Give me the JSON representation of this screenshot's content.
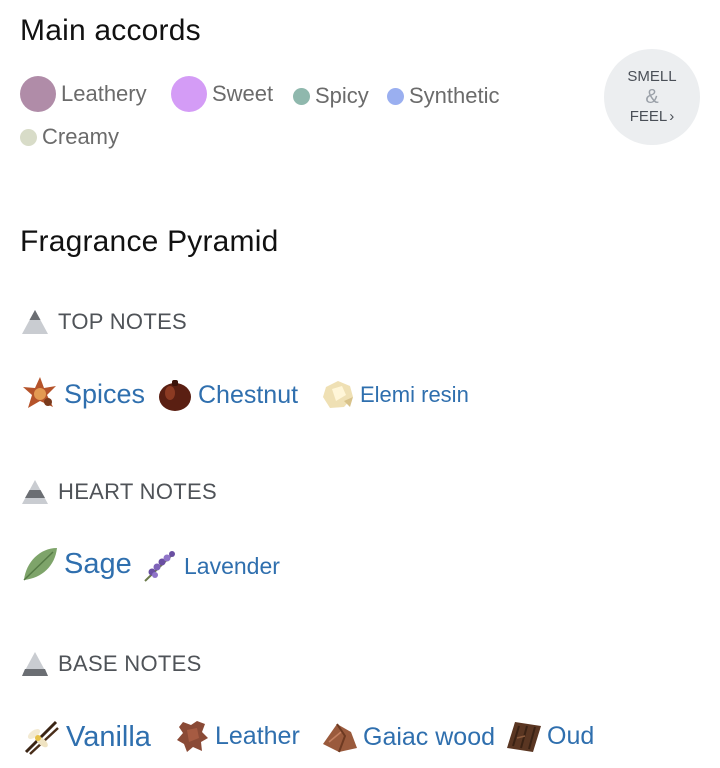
{
  "main_accords": {
    "title": "Main accords",
    "items": [
      {
        "label": "Leathery",
        "color": "#b08ca8"
      },
      {
        "label": "Sweet",
        "color": "#d49cf6"
      },
      {
        "label": "Spicy",
        "color": "#8fb8ad"
      },
      {
        "label": "Synthetic",
        "color": "#9aaff0"
      },
      {
        "label": "Creamy",
        "color": "#d8dcc8"
      }
    ],
    "smell_feel": {
      "line1": "SMELL",
      "amp": "&",
      "line2": "FEEL",
      "chevron": "›"
    }
  },
  "pyramid": {
    "title": "Fragrance Pyramid",
    "top": {
      "label": "TOP NOTES",
      "notes": [
        {
          "name": "Spices",
          "icon": "spices-icon"
        },
        {
          "name": "Chestnut",
          "icon": "chestnut-icon"
        },
        {
          "name": "Elemi resin",
          "icon": "elemi-resin-icon"
        }
      ]
    },
    "heart": {
      "label": "HEART NOTES",
      "notes": [
        {
          "name": "Sage",
          "icon": "sage-icon"
        },
        {
          "name": "Lavender",
          "icon": "lavender-icon"
        }
      ]
    },
    "base": {
      "label": "BASE NOTES",
      "notes": [
        {
          "name": "Vanilla",
          "icon": "vanilla-icon"
        },
        {
          "name": "Leather",
          "icon": "leather-icon"
        },
        {
          "name": "Gaiac wood",
          "icon": "gaiac-wood-icon"
        },
        {
          "name": "Oud",
          "icon": "oud-icon"
        }
      ]
    }
  }
}
